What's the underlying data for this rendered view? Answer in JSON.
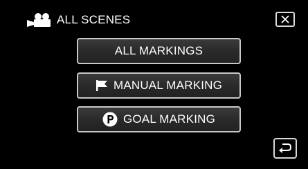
{
  "header": {
    "title": "ALL SCENES",
    "icon": "video-camera-icon"
  },
  "close_button": {
    "icon": "close-icon"
  },
  "menu": {
    "items": [
      {
        "label": "ALL MARKINGS",
        "icon": ""
      },
      {
        "label": "MANUAL MARKING",
        "icon": "flag-icon"
      },
      {
        "label": "GOAL MARKING",
        "icon": "p-circle-icon"
      }
    ]
  },
  "back_button": {
    "icon": "return-arrow-icon"
  },
  "colors": {
    "background": "#000000",
    "text": "#ffffff",
    "button_border": "#c8c8c8"
  }
}
